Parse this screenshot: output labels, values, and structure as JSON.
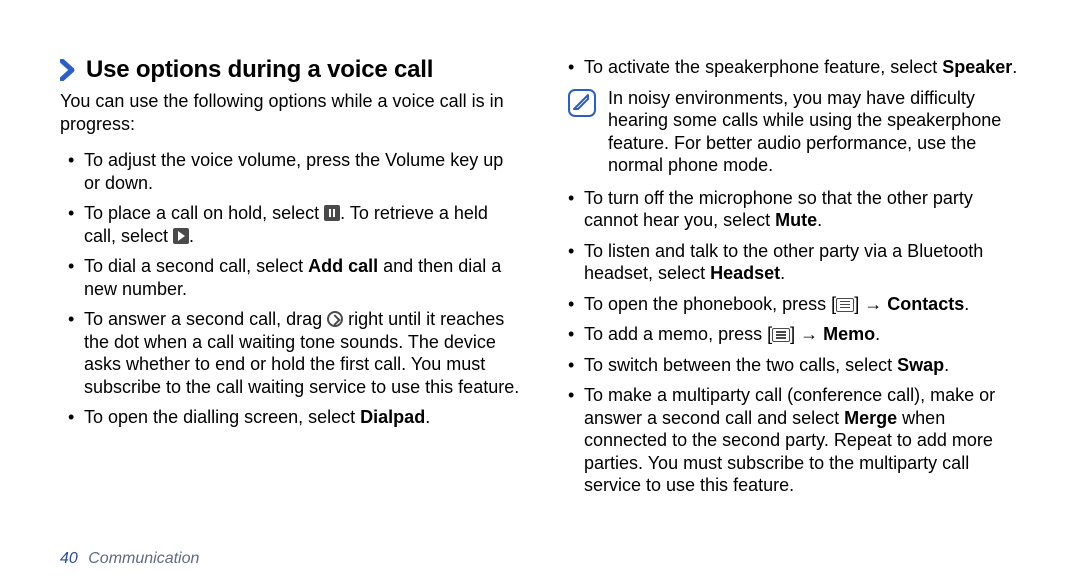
{
  "heading": "Use options during a voice call",
  "intro": "You can use the following options while a voice call is in progress:",
  "left": {
    "b1": "To adjust the voice volume, press the Volume key up or down.",
    "b2a": "To place a call on hold, select ",
    "b2b": ". To retrieve a held call, select ",
    "b2c": ".",
    "b3a": "To dial a second call, select ",
    "b3bold": "Add call",
    "b3b": " and then dial a new number.",
    "b4a": "To answer a second call, drag ",
    "b4b": " right until it reaches the dot when a call waiting tone sounds. The device asks whether to end or hold the first call. You must subscribe to the call waiting service to use this feature.",
    "b5a": "To open the dialling screen, select ",
    "b5bold": "Dialpad",
    "b5b": "."
  },
  "right": {
    "r1a": "To activate the speakerphone feature, select ",
    "r1bold": "Speaker",
    "r1b": ".",
    "note": "In noisy environments, you may have difficulty hearing some calls while using the speakerphone feature. For better audio performance, use the normal phone mode.",
    "r2a": "To turn off the microphone so that the other party cannot hear you, select ",
    "r2bold": "Mute",
    "r2b": ".",
    "r3a": "To listen and talk to the other party via a Bluetooth headset, select ",
    "r3bold": "Headset",
    "r3b": ".",
    "r4a": "To open the phonebook, press [",
    "r4b": "] → ",
    "r4bold": "Contacts",
    "r4c": ".",
    "r5a": "To add a memo, press [",
    "r5b": "] → ",
    "r5bold": "Memo",
    "r5c": ".",
    "r6a": "To switch between the two calls, select ",
    "r6bold": "Swap",
    "r6b": ".",
    "r7a": "To make a multiparty call (conference call), make or answer a second call and select ",
    "r7bold": "Merge",
    "r7b": " when connected to the second party. Repeat to add more parties. You must subscribe to the multiparty call service to use this feature."
  },
  "footer": {
    "page": "40",
    "section": "Communication"
  }
}
